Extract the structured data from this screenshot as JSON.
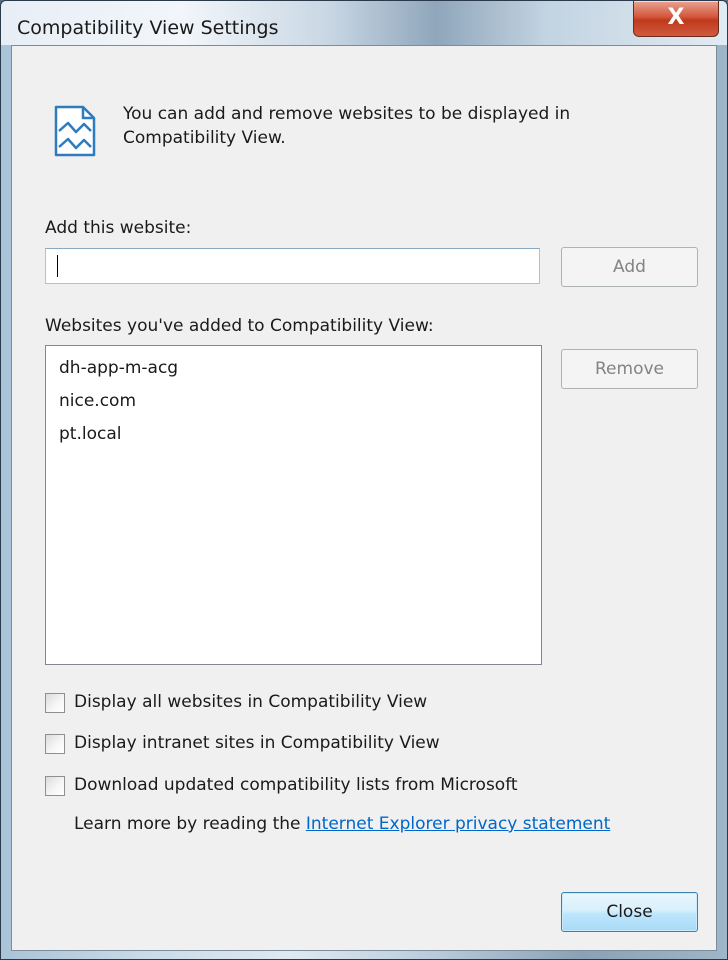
{
  "window": {
    "title": "Compatibility View Settings",
    "close_glyph": "X"
  },
  "intro": {
    "icon": "compatibility-page-icon",
    "text": "You can add and remove websites to be displayed in Compatibility View."
  },
  "add": {
    "label": "Add this website:",
    "value": "",
    "button_label": "Add"
  },
  "sites": {
    "label": "Websites you've added to Compatibility View:",
    "items": [
      "dh-app-m-acg",
      "nice.com",
      "pt.local"
    ],
    "remove_label": "Remove"
  },
  "options": [
    {
      "label": "Display all websites in Compatibility View",
      "checked": false
    },
    {
      "label": "Display intranet sites in Compatibility View",
      "checked": false
    },
    {
      "label": "Download updated compatibility lists from Microsoft",
      "checked": false
    }
  ],
  "learn_more": {
    "prefix": "Learn more by reading the ",
    "link_text": "Internet Explorer privacy statement"
  },
  "footer": {
    "close_label": "Close"
  },
  "colors": {
    "link": "#0066cc",
    "close_accent": "#c0391c"
  }
}
